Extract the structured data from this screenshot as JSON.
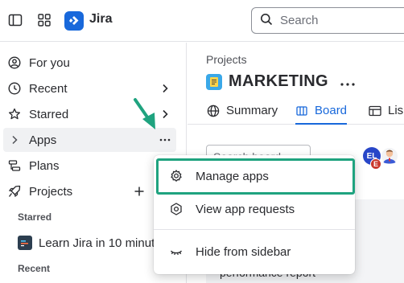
{
  "topbar": {
    "app_name": "Jira",
    "search_placeholder": "Search"
  },
  "sidebar": {
    "items": [
      {
        "label": "For you"
      },
      {
        "label": "Recent"
      },
      {
        "label": "Starred"
      },
      {
        "label": "Apps"
      },
      {
        "label": "Plans"
      },
      {
        "label": "Projects"
      }
    ],
    "starred_section": "Starred",
    "starred_project": "Learn Jira in 10 minut",
    "recent_section": "Recent"
  },
  "main": {
    "breadcrumb": "Projects",
    "project_title": "MARKETING",
    "tabs": [
      {
        "label": "Summary"
      },
      {
        "label": "Board"
      },
      {
        "label": "Lis"
      }
    ],
    "search_board_placeholder": "Search board",
    "avatar_initials": "EL",
    "avatar_badge": "E",
    "card_text_partial": "g",
    "card_text": "performance report"
  },
  "apps_menu": {
    "items": [
      {
        "label": "Manage apps"
      },
      {
        "label": "View app requests"
      },
      {
        "label": "Hide from sidebar"
      }
    ]
  },
  "colors": {
    "accent": "#1868db",
    "highlight": "#1fa37f",
    "hover_bg": "#f0f1f3"
  }
}
